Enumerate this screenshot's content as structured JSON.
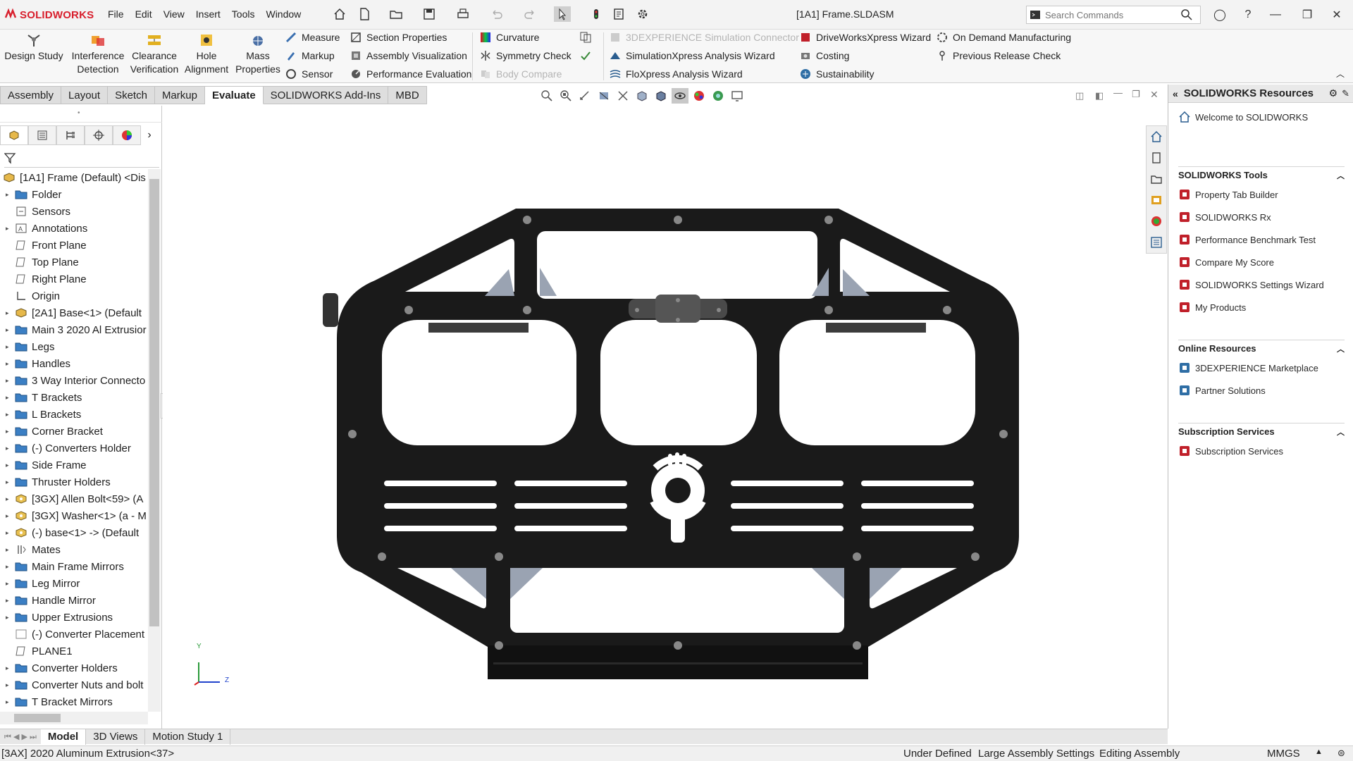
{
  "app": {
    "brand": "SOLIDWORKS",
    "document_title": "[1A1] Frame.SLDASM",
    "menus": [
      "File",
      "Edit",
      "View",
      "Insert",
      "Tools",
      "Window"
    ],
    "search_placeholder": "Search Commands"
  },
  "ribbon": {
    "big_tools": [
      {
        "label": "Design Study",
        "icon": "design-study-icon"
      },
      {
        "label": "Interference Detection",
        "icon": "interference-icon"
      },
      {
        "label": "Clearance Verification",
        "icon": "clearance-icon"
      },
      {
        "label": "Hole Alignment",
        "icon": "hole-alignment-icon"
      },
      {
        "label": "Mass Properties",
        "icon": "mass-properties-icon"
      }
    ],
    "col1": [
      "Measure",
      "Markup",
      "Sensor"
    ],
    "col2": [
      "Section Properties",
      "Assembly Visualization",
      "Performance Evaluation"
    ],
    "col3": [
      "Curvature",
      "Symmetry Check",
      "Body Compare"
    ],
    "col4": [
      "3DEXPERIENCE Simulation Connector",
      "SimulationXpress Analysis Wizard",
      "FloXpress Analysis Wizard"
    ],
    "col5": [
      "DriveWorksXpress Wizard",
      "Costing",
      "Sustainability"
    ],
    "col6": [
      "On Demand Manufacturing",
      "Previous Release Check"
    ]
  },
  "tabs": [
    "Assembly",
    "Layout",
    "Sketch",
    "Markup",
    "Evaluate",
    "SOLIDWORKS Add-Ins",
    "MBD"
  ],
  "active_tab": "Evaluate",
  "tree": {
    "root": "[1A1] Frame (Default) <Dis",
    "items": [
      {
        "label": "Folder",
        "icon": "folder-icon",
        "expandable": true
      },
      {
        "label": "Sensors",
        "icon": "sensor-icon",
        "expandable": false
      },
      {
        "label": "Annotations",
        "icon": "annotations-icon",
        "expandable": true
      },
      {
        "label": "Front Plane",
        "icon": "plane-icon",
        "expandable": false
      },
      {
        "label": "Top Plane",
        "icon": "plane-icon",
        "expandable": false
      },
      {
        "label": "Right Plane",
        "icon": "plane-icon",
        "expandable": false
      },
      {
        "label": "Origin",
        "icon": "origin-icon",
        "expandable": false
      },
      {
        "label": "[2A1] Base<1> (Default",
        "icon": "assembly-icon",
        "expandable": true
      },
      {
        "label": "Main 3 2020 Al Extrusior",
        "icon": "folder-icon",
        "expandable": true
      },
      {
        "label": "Legs",
        "icon": "folder-icon",
        "expandable": true
      },
      {
        "label": "Handles",
        "icon": "folder-icon",
        "expandable": true
      },
      {
        "label": "3 Way Interior Connecto",
        "icon": "folder-icon",
        "expandable": true
      },
      {
        "label": "T Brackets",
        "icon": "folder-icon",
        "expandable": true
      },
      {
        "label": "L Brackets",
        "icon": "folder-icon",
        "expandable": true
      },
      {
        "label": "Corner Bracket",
        "icon": "folder-icon",
        "expandable": true
      },
      {
        "label": "(-) Converters Holder",
        "icon": "folder-icon",
        "expandable": true
      },
      {
        "label": "Side Frame",
        "icon": "folder-icon",
        "expandable": true
      },
      {
        "label": "Thruster Holders",
        "icon": "folder-icon",
        "expandable": true
      },
      {
        "label": "[3GX] Allen Bolt<59> (A",
        "icon": "part-icon",
        "expandable": true
      },
      {
        "label": "[3GX] Washer<1> (a - M",
        "icon": "part-icon",
        "expandable": true
      },
      {
        "label": "(-) base<1> -> (Default",
        "icon": "part-icon",
        "expandable": true
      },
      {
        "label": "Mates",
        "icon": "mates-icon",
        "expandable": true
      },
      {
        "label": "Main Frame Mirrors",
        "icon": "folder-icon",
        "expandable": true
      },
      {
        "label": "Leg Mirror",
        "icon": "folder-icon",
        "expandable": true
      },
      {
        "label": "Handle Mirror",
        "icon": "folder-icon",
        "expandable": true
      },
      {
        "label": "Upper Extrusions",
        "icon": "folder-icon",
        "expandable": true
      },
      {
        "label": "(-) Converter Placement",
        "icon": "sketch-icon",
        "expandable": false
      },
      {
        "label": "PLANE1",
        "icon": "plane-icon",
        "expandable": false
      },
      {
        "label": "Converter Holders",
        "icon": "folder-icon",
        "expandable": true
      },
      {
        "label": "Converter Nuts and bolt",
        "icon": "folder-icon",
        "expandable": true
      },
      {
        "label": "T Bracket Mirrors",
        "icon": "folder-icon",
        "expandable": true
      }
    ]
  },
  "triad": {
    "y": "Y",
    "z": "Z"
  },
  "taskpane": {
    "title": "SOLIDWORKS Resources",
    "welcome": "Welcome to SOLIDWORKS",
    "tools_title": "SOLIDWORKS Tools",
    "tools": [
      "Property Tab Builder",
      "SOLIDWORKS Rx",
      "Performance Benchmark Test",
      "Compare My Score",
      "SOLIDWORKS Settings Wizard",
      "My Products"
    ],
    "online_title": "Online Resources",
    "online": [
      "3DEXPERIENCE Marketplace",
      "Partner Solutions"
    ],
    "subs_title": "Subscription Services",
    "subs": [
      "Subscription Services"
    ]
  },
  "bottom_tabs": [
    "Model",
    "3D Views",
    "Motion Study 1"
  ],
  "status": {
    "selection": "[3AX] 2020 Aluminum Extrusion<37>",
    "state": "Under Defined",
    "large_assembly": "Large Assembly Settings",
    "mode": "Editing Assembly",
    "units": "MMGS"
  },
  "colors": {
    "brand_red": "#d81e2c",
    "model_black": "#1a1a1a",
    "bracket_gray": "#9aa3b2"
  }
}
